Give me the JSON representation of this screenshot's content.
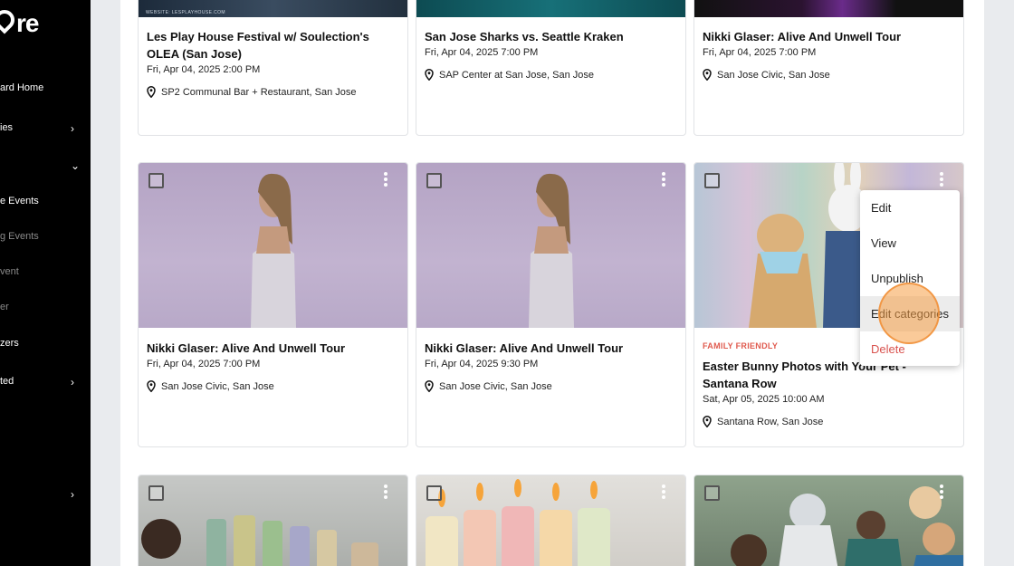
{
  "sidebar": {
    "logo": "re",
    "items": [
      {
        "label": "ard Home",
        "dim": false,
        "chevron": ""
      },
      {
        "label": "ies",
        "dim": false,
        "chevron": "›"
      },
      {
        "label": "",
        "dim": false,
        "chevron": "⌄"
      },
      {
        "label": "e Events",
        "dim": false,
        "chevron": ""
      },
      {
        "label": "g Events",
        "dim": true,
        "chevron": ""
      },
      {
        "label": "vent",
        "dim": true,
        "chevron": ""
      },
      {
        "label": "er",
        "dim": true,
        "chevron": ""
      },
      {
        "label": "zers",
        "dim": false,
        "chevron": ""
      },
      {
        "label": "ted",
        "dim": false,
        "chevron": "›"
      },
      {
        "label": "",
        "dim": false,
        "chevron": "›"
      }
    ]
  },
  "events_row1": [
    {
      "title": "Les Play House Festival w/ Soulection's OLEA (San Jose)",
      "date": "Fri, Apr 04, 2025 2:00 PM",
      "location": "SP2 Communal Bar + Restaurant, San Jose",
      "image_text": "WEBSITE: LESPLAYHOUSE.COM"
    },
    {
      "title": "San Jose Sharks vs. Seattle Kraken",
      "date": "Fri, Apr 04, 2025 7:00 PM",
      "location": "SAP Center at San Jose, San Jose"
    },
    {
      "title": "Nikki Glaser: Alive And Unwell Tour",
      "date": "Fri, Apr 04, 2025 7:00 PM",
      "location": "San Jose Civic, San Jose"
    }
  ],
  "events_row2": [
    {
      "title": "Nikki Glaser: Alive And Unwell Tour",
      "date": "Fri, Apr 04, 2025 7:00 PM",
      "location": "San Jose Civic, San Jose",
      "category": ""
    },
    {
      "title": "Nikki Glaser: Alive And Unwell Tour",
      "date": "Fri, Apr 04, 2025 9:30 PM",
      "location": "San Jose Civic, San Jose",
      "category": ""
    },
    {
      "title": "Easter Bunny Photos with Your Pet - Santana Row",
      "date": "Sat, Apr 05, 2025 10:00 AM",
      "location": "Santana Row, San Jose",
      "category": "FAMILY FRIENDLY"
    }
  ],
  "context_menu": {
    "items": [
      "Edit",
      "View",
      "Unpublish",
      "Edit categories",
      "Delete"
    ],
    "highlighted": "Edit categories"
  },
  "colors": {
    "sidebar_bg": "#000000",
    "category_accent": "#e05a4e",
    "delete_text": "#d9534f",
    "click_indicator": "#f59e46"
  }
}
